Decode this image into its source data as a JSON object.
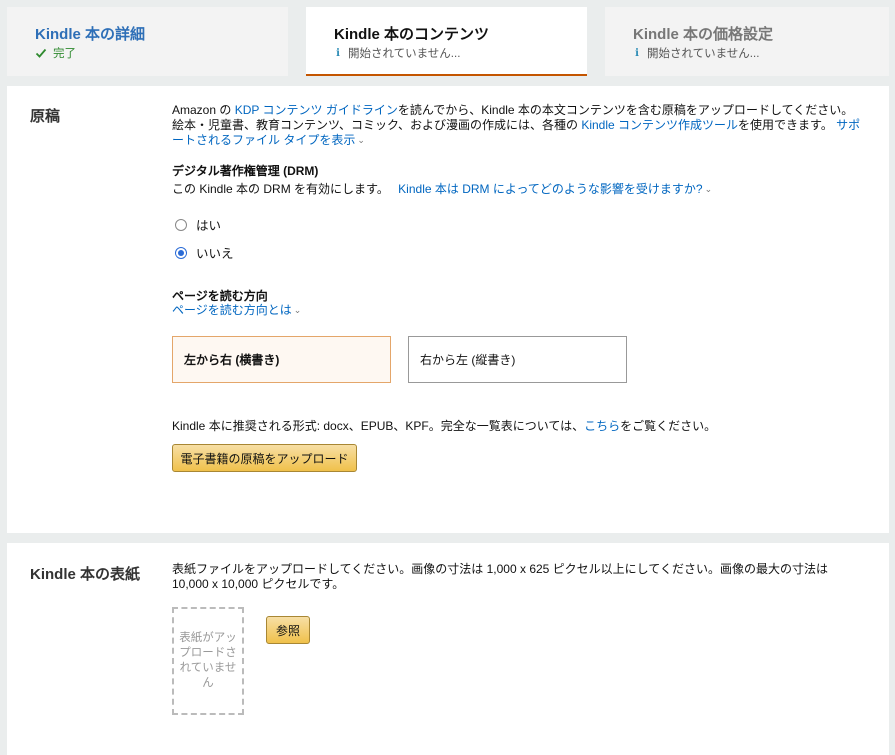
{
  "tabs": [
    {
      "title": "Kindle 本の詳細",
      "status": "完了",
      "status_icon": "check-icon"
    },
    {
      "title": "Kindle 本のコンテンツ",
      "status": "開始されていません...",
      "status_icon": "info-icon"
    },
    {
      "title": "Kindle 本の価格設定",
      "status": "開始されていません...",
      "status_icon": "info-icon"
    }
  ],
  "manuscript": {
    "title": "原稿",
    "desc": {
      "p1": "Amazon の ",
      "link1": "KDP コンテンツ ガイドライン",
      "p2": "を読んでから、Kindle 本の本文コンテンツを含む原稿をアップロードしてください。絵本・児童書、教育コンテンツ、コミック、および漫画の作成には、各種の ",
      "link2": "Kindle コンテンツ作成ツール",
      "p3": "を使用できます。",
      "link3": "サポートされるファイル タイプを表示"
    },
    "drm": {
      "heading": "デジタル著作権管理 (DRM)",
      "question": "この Kindle 本の DRM を有効にします。",
      "help_link": "Kindle 本は DRM によってどのような影響を受けますか?",
      "options": [
        {
          "label": "はい",
          "selected": false
        },
        {
          "label": "いいえ",
          "selected": true
        }
      ]
    },
    "direction": {
      "heading": "ページを読む方向",
      "help_link": "ページを読む方向とは",
      "options": [
        {
          "label": "左から右 (横書き)",
          "selected": true
        },
        {
          "label": "右から左 (縦書き)",
          "selected": false
        }
      ]
    },
    "formats": {
      "before": "Kindle 本に推奨される形式: docx、EPUB、KPF。完全な一覧表については、",
      "link": "こちら",
      "after": "をご覧ください。"
    },
    "upload_button": "電子書籍の原稿をアップロード"
  },
  "cover": {
    "title": "Kindle 本の表紙",
    "desc": "表紙ファイルをアップロードしてください。画像の寸法は 1,000 x 625 ピクセル以上にしてください。画像の最大の寸法は 10,000 x 10,000 ピクセルです。",
    "placeholder": "表紙がアップロードされていません",
    "browse_button": "参照"
  },
  "colors": {
    "link": "#0066c0",
    "active_tab_underline": "#c45500",
    "button_yellow": "#f0c14b",
    "success_green": "#2f8a2f"
  }
}
